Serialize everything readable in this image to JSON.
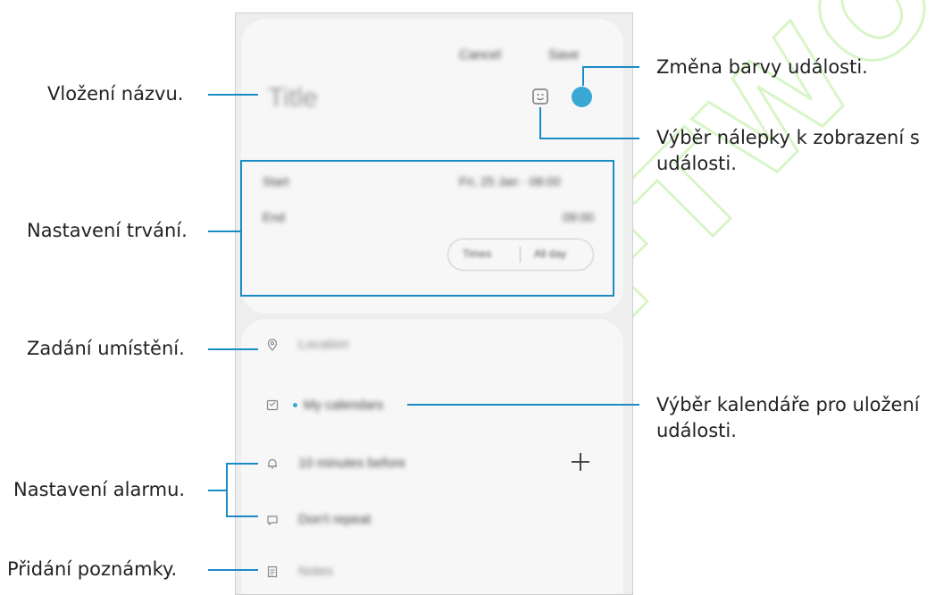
{
  "screen": {
    "header": {
      "cancel_label": "Cancel",
      "save_label": "Save"
    },
    "title_placeholder": "Title",
    "duration": {
      "start_label": "Start",
      "start_value": "Fri, 25 Jan · 08:00",
      "end_label": "End",
      "end_value": "09:00",
      "toggle_left": "Times",
      "toggle_right": "All day"
    },
    "details": {
      "location_placeholder": "Location",
      "calendar_name": "My calendars",
      "alarm_value": "10 minutes before",
      "repeat_value": "Don't repeat",
      "notes_placeholder": "Notes"
    }
  },
  "annotations": {
    "title": "Vložení názvu.",
    "duration": "Nastavení trvání.",
    "location": "Zadání umístění.",
    "alarm": "Nastavení alarmu.",
    "notes": "Přidání poznámky.",
    "color": "Změna barvy události.",
    "sticker_line1": "Výběr nálepky k zobrazení s",
    "sticker_line2": "události.",
    "calendar_line1": "Výběr kalendáře pro uložení",
    "calendar_line2": "události."
  },
  "watermark_text": "SOFTWORLD",
  "colors": {
    "accent": "#1b8bc7",
    "event_color": "#3ba7d4",
    "watermark_green": "#7bd94a"
  },
  "icons": [
    "sticker-icon",
    "location-pin-icon",
    "calendar-icon",
    "bell-icon",
    "repeat-icon",
    "notes-icon",
    "plus-icon"
  ]
}
